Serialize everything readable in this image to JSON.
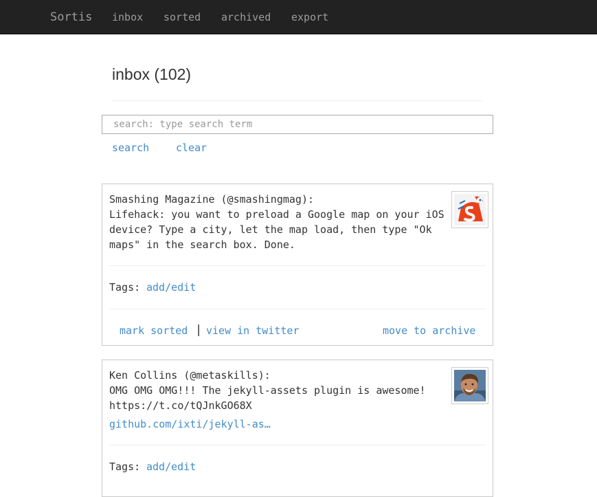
{
  "navbar": {
    "brand": "Sortis",
    "links": [
      "inbox",
      "sorted",
      "archived",
      "export"
    ]
  },
  "page": {
    "title": "inbox (102)",
    "search_placeholder": "search: type search term",
    "search_label": "search",
    "clear_label": "clear"
  },
  "tweets": [
    {
      "author": "Smashing Magazine (@smashingmag):",
      "text": "Lifehack: you want to preload a Google map on your iOS device? Type a city, let the map load, then type \"Ok maps\" in the search box. Done.",
      "tags_label": "Tags:",
      "tags_link": "add/edit",
      "avatar": "smashing-magazine-logo",
      "actions": {
        "mark_sorted": "mark sorted",
        "separator": "|",
        "view_twitter": "view in twitter",
        "archive": "move to archive"
      }
    },
    {
      "author": "Ken Collins (@metaskills):",
      "text": "OMG OMG OMG!!! The jekyll-assets plugin is awesome! https://t.co/tQJnkGO68X",
      "link": "github.com/ixti/jekyll-as…",
      "tags_label": "Tags:",
      "tags_link": "add/edit",
      "avatar": "user-photo"
    }
  ],
  "colors": {
    "navbar_bg": "#222222",
    "nav_text": "#9d9d9d",
    "link": "#428bca",
    "text": "#333333"
  }
}
